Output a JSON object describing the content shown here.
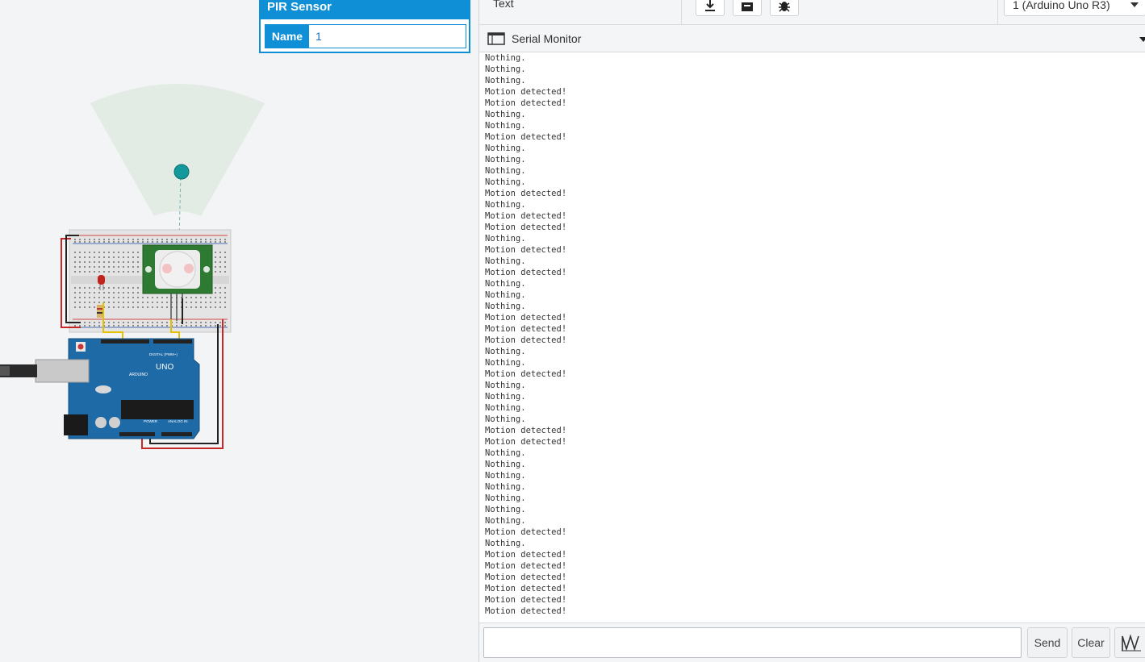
{
  "properties_panel": {
    "title": "PIR Sensor",
    "name_label": "Name",
    "name_value": "1"
  },
  "toolbar": {
    "mode_label": "Text",
    "buttons": [
      "download-icon",
      "upload-icon",
      "debug-bug-icon"
    ],
    "device_select_value": "1 (Arduino Uno R3)"
  },
  "serial_monitor": {
    "title": "Serial Monitor",
    "lines": [
      "Nothing.",
      "Nothing.",
      "Nothing.",
      "Motion detected!",
      "Motion detected!",
      "Nothing.",
      "Nothing.",
      "Motion detected!",
      "Nothing.",
      "Nothing.",
      "Nothing.",
      "Nothing.",
      "Motion detected!",
      "Nothing.",
      "Motion detected!",
      "Motion detected!",
      "Nothing.",
      "Motion detected!",
      "Nothing.",
      "Motion detected!",
      "Nothing.",
      "Nothing.",
      "Nothing.",
      "Motion detected!",
      "Motion detected!",
      "Motion detected!",
      "Nothing.",
      "Nothing.",
      "Motion detected!",
      "Nothing.",
      "Nothing.",
      "Nothing.",
      "Nothing.",
      "Motion detected!",
      "Motion detected!",
      "Nothing.",
      "Nothing.",
      "Nothing.",
      "Nothing.",
      "Nothing.",
      "Nothing.",
      "Nothing.",
      "Motion detected!",
      "Nothing.",
      "Motion detected!",
      "Motion detected!",
      "Motion detected!",
      "Motion detected!",
      "Motion detected!",
      "Motion detected!"
    ],
    "input_value": "",
    "send_label": "Send",
    "clear_label": "Clear"
  },
  "circuit": {
    "board_label": "UNO",
    "brand_label": "ARDUINO",
    "digital_label": "DIGITAL (PWM~)",
    "power_label": "POWER",
    "analog_label": "ANALOG IN"
  }
}
